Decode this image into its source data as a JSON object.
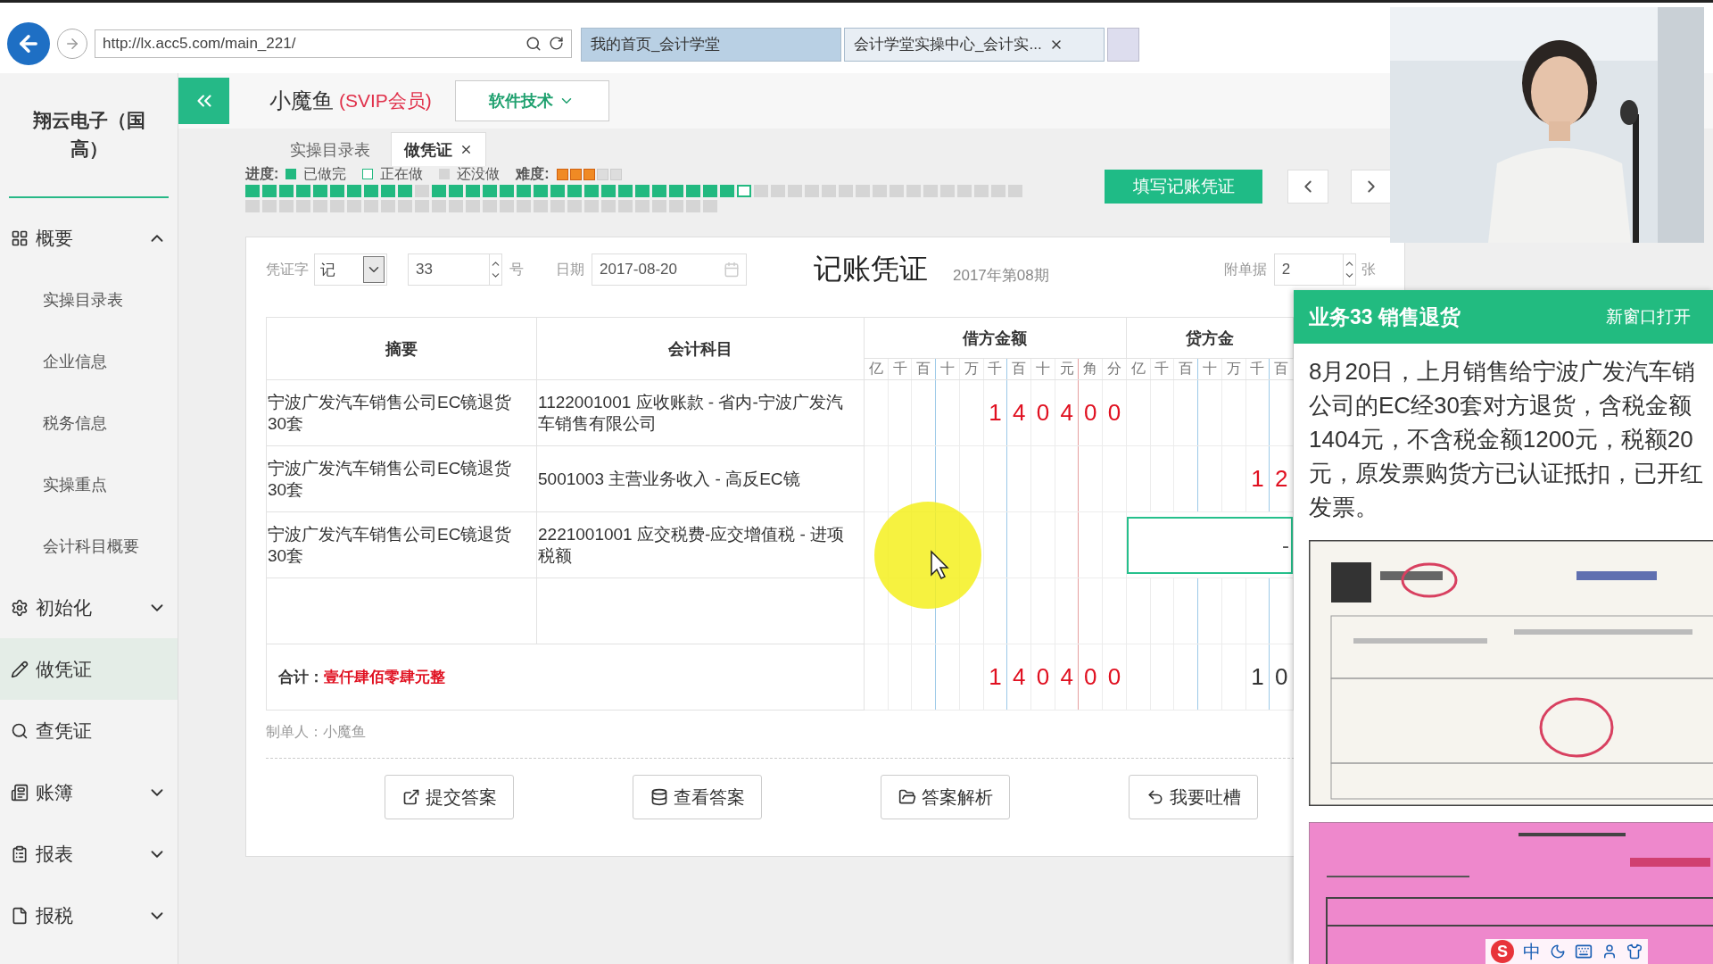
{
  "browser": {
    "url": "http://lx.acc5.com/main_221/",
    "tabs": [
      {
        "label": "我的首页_会计学堂",
        "selected": false
      },
      {
        "label": "会计学堂实操中心_会计实...",
        "selected": true
      }
    ]
  },
  "header": {
    "user": "小魔鱼",
    "member": "(SVIP会员)",
    "menu": "软件技术"
  },
  "page_tabs": [
    {
      "label": "实操目录表",
      "selected": false
    },
    {
      "label": "做凭证",
      "selected": true
    }
  ],
  "sidebar": {
    "company": "翔云电子（国高）",
    "items": [
      {
        "label": "概要",
        "expanded": true,
        "selected": false,
        "children": [
          {
            "label": "实操目录表"
          },
          {
            "label": "企业信息"
          },
          {
            "label": "税务信息"
          },
          {
            "label": "实操重点"
          },
          {
            "label": "会计科目概要"
          }
        ]
      },
      {
        "label": "初始化",
        "expanded": false,
        "selected": false
      },
      {
        "label": "做凭证",
        "selected": true
      },
      {
        "label": "查凭证",
        "selected": false
      },
      {
        "label": "账簿",
        "expanded": false,
        "selected": false
      },
      {
        "label": "报表",
        "expanded": false,
        "selected": false
      },
      {
        "label": "报税",
        "expanded": false,
        "selected": false
      }
    ]
  },
  "progress": {
    "label": "进度:",
    "legend": [
      "已做完",
      "正在做",
      "还没做"
    ],
    "difficulty_label": "难度:",
    "stars": 3,
    "cells": [
      {
        "done": true,
        "current": false
      },
      {
        "done": true,
        "current": false
      },
      {
        "done": true,
        "current": false
      },
      {
        "done": true,
        "current": false
      },
      {
        "done": true,
        "current": false
      },
      {
        "done": true,
        "current": false
      },
      {
        "done": true,
        "current": false
      },
      {
        "done": true,
        "current": false
      },
      {
        "done": true,
        "current": false
      },
      {
        "done": true,
        "current": false
      },
      {
        "done": false,
        "current": false
      },
      {
        "done": true,
        "current": false
      },
      {
        "done": true,
        "current": false
      },
      {
        "done": true,
        "current": false
      },
      {
        "done": true,
        "current": false
      },
      {
        "done": true,
        "current": false
      },
      {
        "done": true,
        "current": false
      },
      {
        "done": true,
        "current": false
      },
      {
        "done": true,
        "current": false
      },
      {
        "done": true,
        "current": false
      },
      {
        "done": true,
        "current": false
      },
      {
        "done": true,
        "current": false
      },
      {
        "done": true,
        "current": false
      },
      {
        "done": true,
        "current": false
      },
      {
        "done": true,
        "current": false
      },
      {
        "done": true,
        "current": false
      },
      {
        "done": true,
        "current": false
      },
      {
        "done": true,
        "current": false
      },
      {
        "done": true,
        "current": false
      },
      {
        "done": false,
        "current": true
      },
      {
        "done": false,
        "current": false
      },
      {
        "done": false,
        "current": false
      },
      {
        "done": false,
        "current": false
      },
      {
        "done": false,
        "current": false
      },
      {
        "done": false,
        "current": false
      },
      {
        "done": false,
        "current": false
      },
      {
        "done": false,
        "current": false
      },
      {
        "done": false,
        "current": false
      },
      {
        "done": false,
        "current": false
      },
      {
        "done": false,
        "current": false
      },
      {
        "done": false,
        "current": false
      },
      {
        "done": false,
        "current": false
      },
      {
        "done": false,
        "current": false
      },
      {
        "done": false,
        "current": false
      },
      {
        "done": false,
        "current": false
      },
      {
        "done": false,
        "current": false
      },
      {
        "done": false,
        "current": false
      },
      {
        "done": false,
        "current": false
      },
      {
        "done": false,
        "current": false
      },
      {
        "done": false,
        "current": false
      },
      {
        "done": false,
        "current": false
      },
      {
        "done": false,
        "current": false
      },
      {
        "done": false,
        "current": false
      },
      {
        "done": false,
        "current": false
      },
      {
        "done": false,
        "current": false
      },
      {
        "done": false,
        "current": false
      },
      {
        "done": false,
        "current": false
      },
      {
        "done": false,
        "current": false
      },
      {
        "done": false,
        "current": false
      },
      {
        "done": false,
        "current": false
      },
      {
        "done": false,
        "current": false
      },
      {
        "done": false,
        "current": false
      },
      {
        "done": false,
        "current": false
      },
      {
        "done": false,
        "current": false
      },
      {
        "done": false,
        "current": false
      },
      {
        "done": false,
        "current": false
      },
      {
        "done": false,
        "current": false
      },
      {
        "done": false,
        "current": false
      },
      {
        "done": false,
        "current": false
      },
      {
        "done": false,
        "current": false
      },
      {
        "done": false,
        "current": false
      },
      {
        "done": false,
        "current": false
      },
      {
        "done": false,
        "current": false
      },
      {
        "done": false,
        "current": false
      }
    ]
  },
  "fill_button": "填写记账凭证",
  "voucher": {
    "type_label": "凭证字",
    "type": "记",
    "number": "33",
    "number_suffix": "号",
    "date_label": "日期",
    "date": "2017-08-20",
    "title": "记账凭证",
    "period": "2017年第08期",
    "attach_label": "附单据",
    "attachments": "2",
    "attach_suffix": "张",
    "columns": {
      "summary": "摘要",
      "account": "会计科目",
      "debit": "借方金额",
      "credit": "贷方金",
      "debit_units": [
        "亿",
        "千",
        "百",
        "十",
        "万",
        "千",
        "百",
        "十",
        "元",
        "角",
        "分"
      ],
      "credit_units": [
        "亿",
        "千",
        "百",
        "十",
        "万",
        "千",
        "百"
      ]
    },
    "rows": [
      {
        "kind": "entry",
        "summary": "宁波广发汽车销售公司EC镜退货30套",
        "account": "1122001001 应收账款 - 省内-宁波广发汽车销售有限公司",
        "debit": [
          "1",
          "4",
          "0",
          "4",
          "0",
          "0"
        ]
      },
      {
        "kind": "entry",
        "summary": "宁波广发汽车销售公司EC镜退货30套",
        "account": "5001003 主营业务收入 - 高反EC镜",
        "credit": [
          "1",
          "2"
        ]
      },
      {
        "kind": "entry",
        "summary": "宁波广发汽车销售公司EC镜退货30套",
        "account": "2221001001 应交税费-应交增值税 - 进项税额",
        "credit_field": "-"
      },
      {
        "kind": "blank"
      }
    ],
    "total": {
      "label": "合计：",
      "words": "壹仟肆佰零肆元整",
      "debit": [
        "1",
        "4",
        "0",
        "4",
        "0",
        "0"
      ],
      "credit": [
        "1",
        "0"
      ],
      "credit_balanced": false
    },
    "maker": "制单人：小魔鱼",
    "buttons": [
      "提交答案",
      "查看答案",
      "答案解析",
      "我要吐槽"
    ]
  },
  "task_panel": {
    "title": "业务33 销售退货",
    "open_new": "新窗口打开",
    "text": [
      "8月20日，上月销售给宁波广发汽车销",
      "公司的EC经30套对方退货，含税金额",
      "1404元，不含税金额1200元，税额20",
      "元，原发票购货方已认证抵扣，已开红",
      "发票。"
    ],
    "attachments": [
      {
        "kind": "picture"
      },
      {
        "kind": "picture"
      }
    ]
  },
  "ime": {
    "logo": "S",
    "mode": "中"
  }
}
